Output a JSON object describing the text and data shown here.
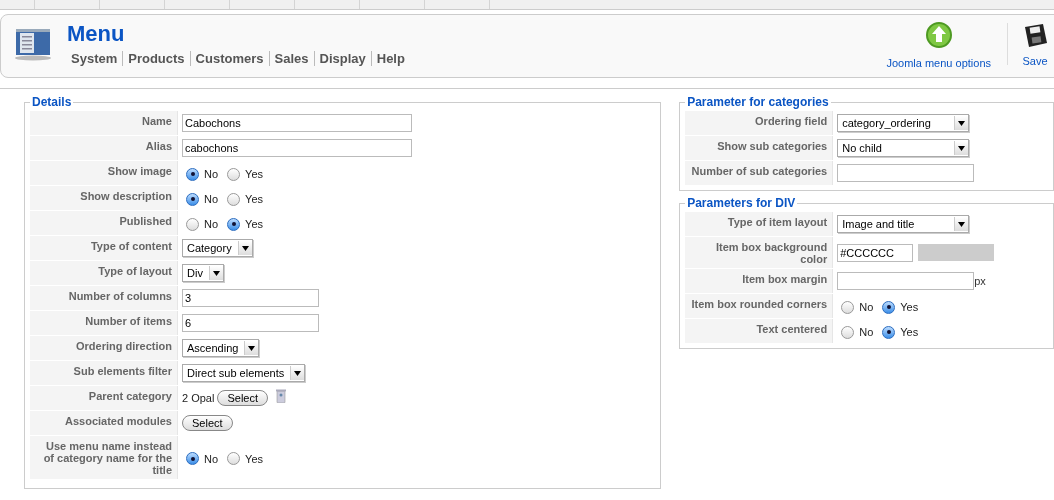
{
  "header": {
    "title": "Menu",
    "nav": [
      "System",
      "Products",
      "Customers",
      "Sales",
      "Display",
      "Help"
    ],
    "toolbar": [
      {
        "label": "Joomla menu options",
        "kind": "options"
      },
      {
        "label": "Save",
        "kind": "save"
      }
    ]
  },
  "sections": [
    {
      "title": "Details",
      "rows": [
        {
          "label": "Name",
          "kind": "text",
          "value": "Cabochons"
        },
        {
          "label": "Alias",
          "kind": "text",
          "value": "cabochons"
        },
        {
          "label": "Show image",
          "kind": "radio",
          "options": [
            {
              "label": "No",
              "selected": true
            },
            {
              "label": "Yes",
              "selected": false
            }
          ]
        },
        {
          "label": "Show description",
          "kind": "radio",
          "options": [
            {
              "label": "No",
              "selected": true
            },
            {
              "label": "Yes",
              "selected": false
            }
          ]
        },
        {
          "label": "Published",
          "kind": "radio",
          "options": [
            {
              "label": "No",
              "selected": false
            },
            {
              "label": "Yes",
              "selected": true
            }
          ]
        },
        {
          "label": "Type of content",
          "kind": "select",
          "value": "Category"
        },
        {
          "label": "Type of layout",
          "kind": "select",
          "value": "Div"
        },
        {
          "label": "Number of columns",
          "kind": "number",
          "value": "3"
        },
        {
          "label": "Number of items",
          "kind": "number",
          "value": "6"
        },
        {
          "label": "Ordering direction",
          "kind": "select",
          "value": "Ascending"
        },
        {
          "label": "Sub elements filter",
          "kind": "select",
          "value": "Direct sub elements"
        },
        {
          "label": "Parent category",
          "kind": "picker",
          "value": "2 Opal",
          "button": "Select"
        },
        {
          "label": "Associated modules",
          "kind": "button",
          "button": "Select"
        },
        {
          "label": "Use menu name instead of category name for the title",
          "kind": "radio",
          "options": [
            {
              "label": "No",
              "selected": true
            },
            {
              "label": "Yes",
              "selected": false
            }
          ]
        }
      ]
    },
    {
      "title": "Parameter for categories",
      "rows": [
        {
          "label": "Ordering field",
          "kind": "select",
          "value": "category_ordering"
        },
        {
          "label": "Show sub categories",
          "kind": "select",
          "value": "No child"
        },
        {
          "label": "Number of sub categories",
          "kind": "number"
        }
      ]
    },
    {
      "title": "Parameters for DIV",
      "rows": [
        {
          "label": "Type of item layout",
          "kind": "select",
          "value": "Image and title"
        },
        {
          "label": "Item box background color",
          "kind": "color",
          "value": "#CCCCCC",
          "color": "#cccccc"
        },
        {
          "label": "Item box margin",
          "kind": "number",
          "suffix": "px"
        },
        {
          "label": "Item box rounded corners",
          "kind": "radio",
          "options": [
            {
              "label": "No",
              "selected": false
            },
            {
              "label": "Yes",
              "selected": true
            }
          ]
        },
        {
          "label": "Text centered",
          "kind": "radio",
          "options": [
            {
              "label": "No",
              "selected": false
            },
            {
              "label": "Yes",
              "selected": true
            }
          ]
        }
      ]
    }
  ]
}
